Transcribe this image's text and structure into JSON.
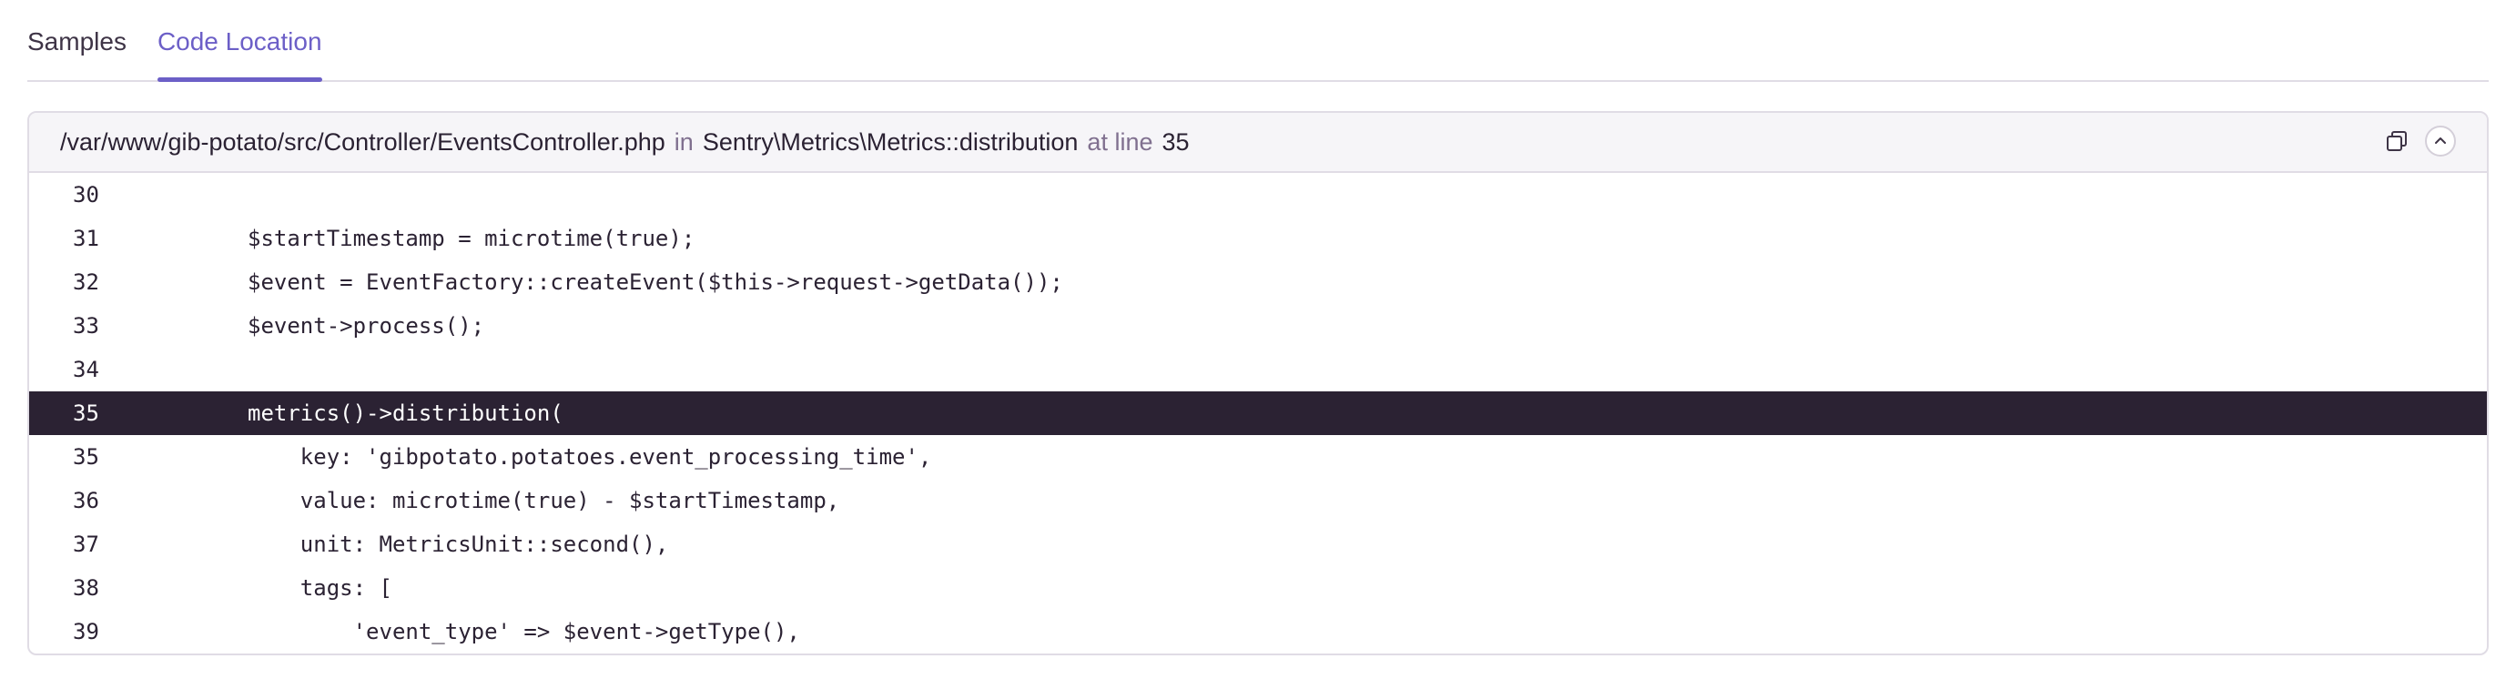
{
  "tabs": [
    {
      "label": "Samples",
      "active": false
    },
    {
      "label": "Code Location",
      "active": true
    }
  ],
  "header": {
    "path": "/var/www/gib-potato/src/Controller/EventsController.php",
    "in_label": "in",
    "function": "Sentry\\Metrics\\Metrics::distribution",
    "at_line_label": "at line",
    "line": "35"
  },
  "icons": {
    "copy": "copy-icon",
    "collapse": "chevron-up-icon"
  },
  "code_lines": [
    {
      "num": "30",
      "text": "",
      "highlight": false
    },
    {
      "num": "31",
      "text": "$startTimestamp = microtime(true);",
      "highlight": false
    },
    {
      "num": "32",
      "text": "$event = EventFactory::createEvent($this->request->getData());",
      "highlight": false
    },
    {
      "num": "33",
      "text": "$event->process();",
      "highlight": false
    },
    {
      "num": "34",
      "text": "",
      "highlight": false
    },
    {
      "num": "35",
      "text": "metrics()->distribution(",
      "highlight": true
    },
    {
      "num": "35",
      "text": "    key: 'gibpotato.potatoes.event_processing_time',",
      "highlight": false
    },
    {
      "num": "36",
      "text": "    value: microtime(true) - $startTimestamp,",
      "highlight": false
    },
    {
      "num": "37",
      "text": "    unit: MetricsUnit::second(),",
      "highlight": false
    },
    {
      "num": "38",
      "text": "    tags: [",
      "highlight": false
    },
    {
      "num": "39",
      "text": "        'event_type' => $event->getType(),",
      "highlight": false
    }
  ],
  "colors": {
    "accent": "#6c5fc7",
    "highlight_bg": "#2b2233"
  }
}
